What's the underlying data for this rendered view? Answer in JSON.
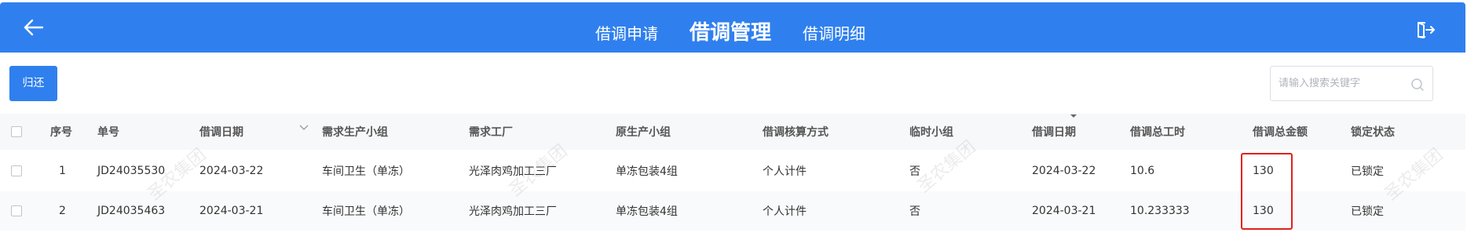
{
  "header": {
    "tabs": [
      {
        "label": "借调申请",
        "active": false
      },
      {
        "label": "借调管理",
        "active": true
      },
      {
        "label": "借调明细",
        "active": false
      }
    ],
    "accent_color": "#2f80ee"
  },
  "toolbar": {
    "return_label": "归还",
    "search_placeholder": "请输入搜索关键字"
  },
  "table": {
    "columns": [
      "序号",
      "单号",
      "借调日期",
      "需求生产小组",
      "需求工厂",
      "原生产小组",
      "借调核算方式",
      "临时小组",
      "借调日期",
      "借调总工时",
      "借调总金额",
      "锁定状态"
    ],
    "rows": [
      [
        "1",
        "JD24035530",
        "2024-03-22",
        "车间卫生（单冻）",
        "光泽肉鸡加工三厂",
        "单冻包装4组",
        "个人计件",
        "否",
        "2024-03-22",
        "10.6",
        "130",
        "已锁定"
      ],
      [
        "2",
        "JD24035463",
        "2024-03-21",
        "车间卫生（单冻）",
        "光泽肉鸡加工三厂",
        "单冻包装4组",
        "个人计件",
        "否",
        "2024-03-21",
        "10.233333",
        "130",
        "已锁定"
      ]
    ]
  },
  "watermark": "圣农集团",
  "highlight_color": "#e0201e"
}
